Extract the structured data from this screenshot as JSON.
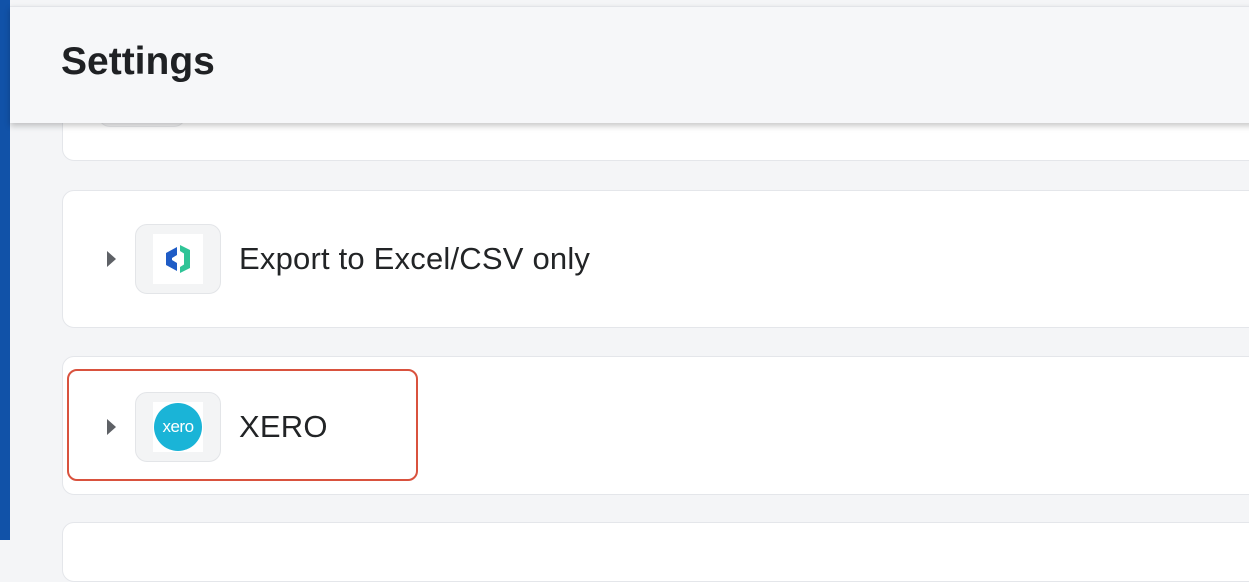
{
  "header": {
    "title": "Settings"
  },
  "integrations": [
    {
      "label": "Export to Excel/CSV only",
      "icon": "excel-csv-export-icon",
      "expanded": false
    },
    {
      "label": "XERO",
      "icon": "xero-logo",
      "logo_text": "xero",
      "expanded": false,
      "highlighted": true
    }
  ],
  "colors": {
    "rail": "#1152a8",
    "highlight": "#d9523e",
    "xero_brand": "#1ab4d7",
    "excel_blue": "#1f5cc6",
    "excel_green": "#2fc497"
  }
}
